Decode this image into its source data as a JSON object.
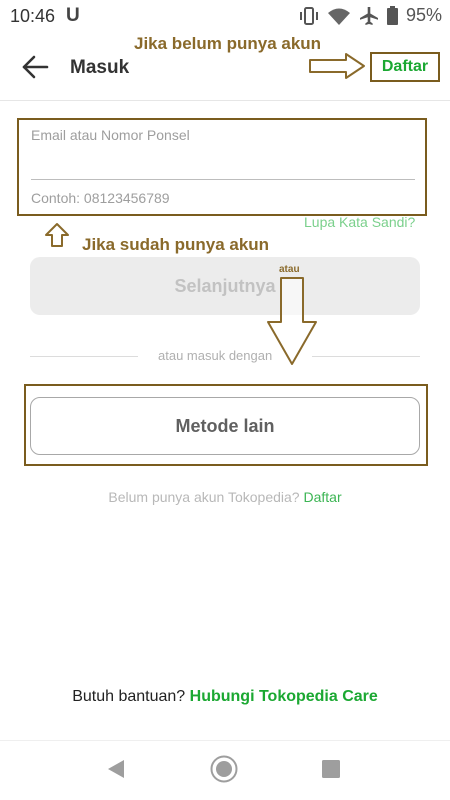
{
  "status_bar": {
    "time": "10:46",
    "notification_glyph": "U",
    "battery_percent": "95%",
    "icons": [
      "vibrate-icon",
      "wifi-icon",
      "airplane-icon",
      "battery-icon"
    ]
  },
  "header": {
    "title": "Masuk",
    "register_button": "Daftar"
  },
  "annotations": {
    "not_have_account": "Jika belum punya akun",
    "have_account": "Jika sudah punya akun",
    "or_label": "atau",
    "annotation_color": "#8a6a2b"
  },
  "login_form": {
    "input_label": "Email atau Nomor Ponsel",
    "input_value": "",
    "input_hint": "Contoh: 08123456789",
    "forgot_password": "Lupa Kata Sandi?",
    "next_button": "Selanjutnya"
  },
  "separator": {
    "text": "atau masuk dengan"
  },
  "other_method": {
    "button": "Metode lain"
  },
  "register_prompt": {
    "text": "Belum punya akun Tokopedia?",
    "link": "Daftar"
  },
  "help": {
    "text": "Butuh bantuan?",
    "link": "Hubungi Tokopedia Care"
  },
  "colors": {
    "brand_green": "#1ba832",
    "annotation_frame": "#7a5c1e"
  }
}
